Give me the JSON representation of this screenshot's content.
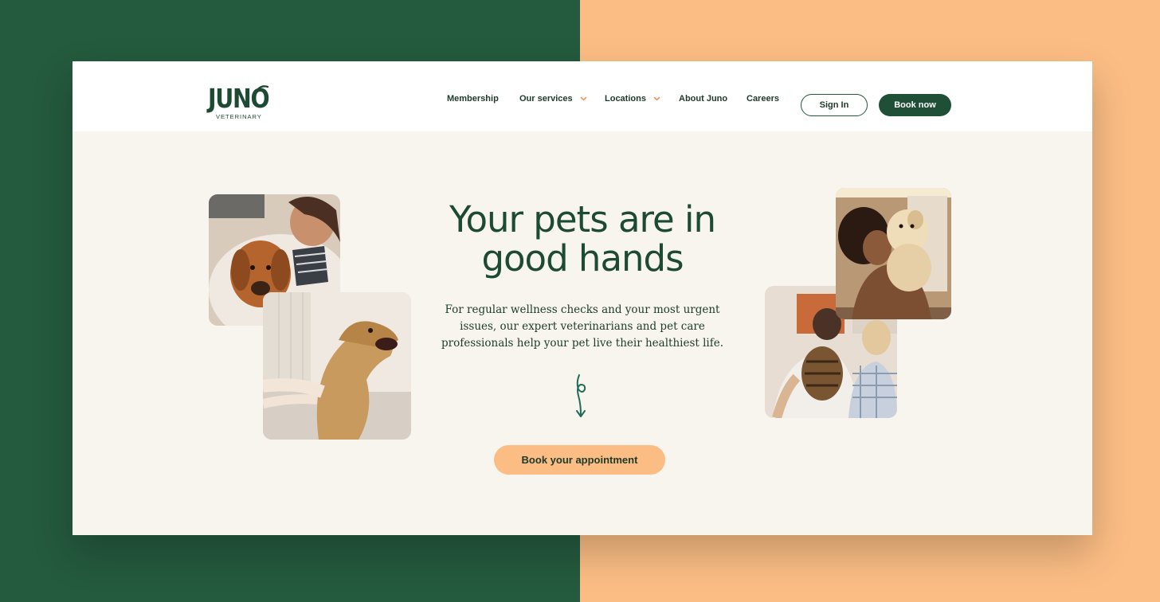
{
  "colors": {
    "brand_green": "#245a3e",
    "brand_green_dark": "#1d4a33",
    "peach": "#fbbd84",
    "cream": "#f8f5ef",
    "text_dark": "#1d3a2a"
  },
  "logo": {
    "wordmark": "JUNO",
    "subtitle": "VETERINARY"
  },
  "nav": {
    "items": [
      {
        "label": "Membership",
        "has_dropdown": false
      },
      {
        "label": "Our services",
        "has_dropdown": true
      },
      {
        "label": "Locations",
        "has_dropdown": true
      },
      {
        "label": "About Juno",
        "has_dropdown": false
      },
      {
        "label": "Careers",
        "has_dropdown": false
      }
    ],
    "signin_label": "Sign In",
    "book_label": "Book now"
  },
  "hero": {
    "headline": "Your pets are in good hands",
    "subtext": "For regular wellness checks and your most urgent issues, our expert veterinarians and pet care professionals help your pet live their healthiest life.",
    "cta_label": "Book your appointment"
  },
  "photos": [
    {
      "name": "woman-with-dachshund-photo"
    },
    {
      "name": "golden-retriever-photo"
    },
    {
      "name": "woman-holding-dog-photo"
    },
    {
      "name": "couple-with-cat-photo"
    }
  ]
}
